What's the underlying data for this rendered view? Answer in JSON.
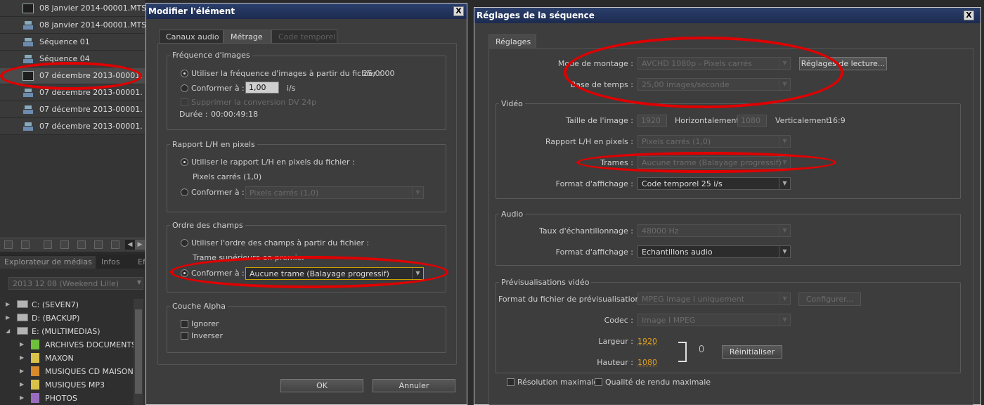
{
  "project": {
    "items": [
      {
        "label": "08 janvier 2014-00001.MTS",
        "kind": "clip"
      },
      {
        "label": "08 janvier 2014-00001.MTS",
        "kind": "sequence"
      },
      {
        "label": "Séquence 01",
        "kind": "sequence"
      },
      {
        "label": "Séquence 04",
        "kind": "sequence"
      },
      {
        "label": "07 décembre 2013-00001.",
        "kind": "clip"
      },
      {
        "label": "07 décembre 2013-00001.",
        "kind": "sequence"
      },
      {
        "label": "07 décembre 2013-00001.",
        "kind": "sequence"
      },
      {
        "label": "07 décembre 2013-00001.",
        "kind": "sequence"
      }
    ],
    "selected_index": 4
  },
  "media": {
    "tabs": [
      "Explorateur de médias",
      "Infos",
      "Eff"
    ],
    "folder": "2013 12 08 (Weekend Lille)",
    "tree": [
      {
        "label": "C: (SEVEN7)",
        "type": "drive",
        "expanded": false
      },
      {
        "label": "D: (BACKUP)",
        "type": "drive",
        "expanded": false
      },
      {
        "label": "E: (MULTIMEDIAS)",
        "type": "drive",
        "expanded": true
      },
      {
        "label": "ARCHIVES DOCUMENTS",
        "type": "folder",
        "color": "#6fbf3a"
      },
      {
        "label": "MAXON",
        "type": "folder",
        "color": "#d8c24a"
      },
      {
        "label": "MUSIQUES CD MAISON",
        "type": "folder",
        "color": "#d98a2b"
      },
      {
        "label": "MUSIQUES MP3",
        "type": "folder",
        "color": "#d8c24a"
      },
      {
        "label": "PHOTOS",
        "type": "folder",
        "color": "#9a6cc0"
      }
    ]
  },
  "modify": {
    "title": "Modifier l'élément",
    "close": "X",
    "tabs": [
      "Canaux audio",
      "Métrage",
      "Code temporel"
    ],
    "framerate": {
      "title": "Fréquence d'images",
      "use_file": "Utiliser la fréquence d'images à partir du fichier :",
      "file_value": "25,0000",
      "conform": "Conformer à :",
      "conform_value": "1,00",
      "unit": "i/s",
      "remove_dv": "Supprimer la conversion DV 24p",
      "duration_label": "Durée :",
      "duration_value": "00:00:49:18"
    },
    "pixel": {
      "title": "Rapport L/H en pixels",
      "use_file": "Utiliser le rapport L/H en pixels du fichier :",
      "file_value": "Pixels carrés (1,0)",
      "conform": "Conformer à :",
      "select_value": "Pixels carrés (1,0)"
    },
    "fields": {
      "title": "Ordre des champs",
      "use_file": "Utiliser l'ordre des champs à partir du fichier :",
      "file_value": "Trame supérieure en premier",
      "conform": "Conformer à :",
      "select_value": "Aucune trame (Balayage progressif)"
    },
    "alpha": {
      "title": "Couche Alpha",
      "ignore": "Ignorer",
      "invert": "Inverser"
    },
    "ok": "OK",
    "cancel": "Annuler"
  },
  "sequence": {
    "title": "Réglages de la séquence",
    "close": "X",
    "tab": "Réglages",
    "edit_mode_label": "Mode de montage :",
    "edit_mode_value": "AVCHD 1080p - Pixels carrés",
    "playback_button": "Réglages de lecture...",
    "timebase_label": "Base de temps :",
    "timebase_value": "25,00 images/seconde",
    "video": {
      "title": "Vidéo",
      "frame_size_label": "Taille de l'image :",
      "width": "1920",
      "horizontal": "Horizontalement",
      "height": "1080",
      "vertical": "Verticalement",
      "ratio": "16:9",
      "pixel_label": "Rapport L/H en pixels :",
      "pixel_value": "Pixels carrés (1,0)",
      "fields_label": "Trames :",
      "fields_value": "Aucune trame (Balayage progressif)",
      "display_label": "Format d'affichage :",
      "display_value": "Code temporel 25 i/s"
    },
    "audio": {
      "title": "Audio",
      "rate_label": "Taux d'échantillonnage :",
      "rate_value": "48000 Hz",
      "display_label": "Format d'affichage :",
      "display_value": "Echantillons audio"
    },
    "preview": {
      "title": "Prévisualisations vidéo",
      "format_label": "Format du fichier de prévisualisation :",
      "format_value": "MPEG image I uniquement",
      "configure": "Configurer...",
      "codec_label": "Codec :",
      "codec_value": "Image I MPEG",
      "width_label": "Largeur :",
      "width_value": "1920",
      "height_label": "Hauteur :",
      "height_value": "1080",
      "reset": "Réinitialiser"
    },
    "max_res": "Résolution maximale",
    "max_quality": "Qualité de rendu maximale"
  }
}
